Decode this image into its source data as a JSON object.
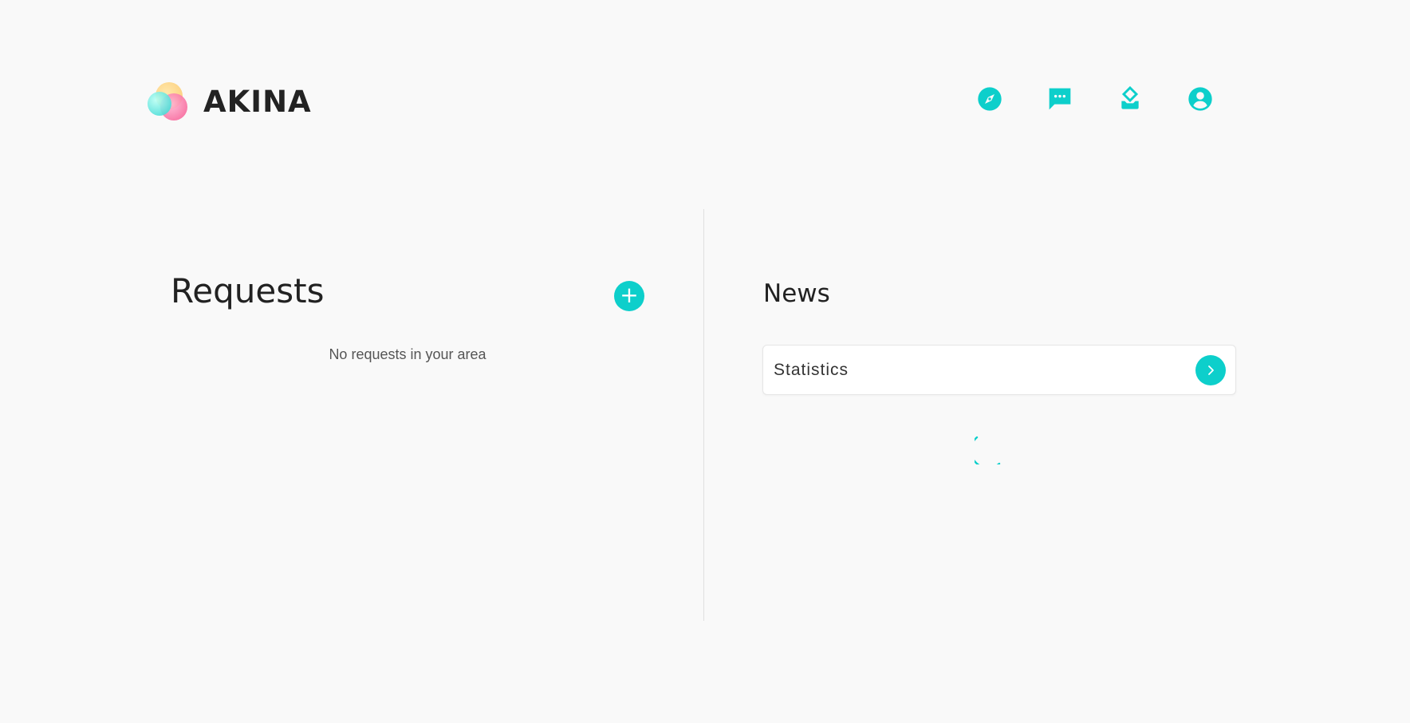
{
  "brand": {
    "name": "AKINA",
    "logo_icon": "akina-logo-icon"
  },
  "nav": {
    "items": [
      {
        "icon": "compass-icon",
        "label": ""
      },
      {
        "icon": "chat-icon",
        "label": ""
      },
      {
        "icon": "vote-icon",
        "label": ""
      },
      {
        "icon": "account-icon",
        "label": ""
      }
    ]
  },
  "requests": {
    "title": "Requests",
    "add_icon": "plus-icon",
    "add_symbol": "+",
    "empty_message": "No requests in your area"
  },
  "news": {
    "title": "News",
    "items": [
      {
        "label": "Statistics",
        "icon": "chevron-right-icon"
      }
    ],
    "loading_icon": "spinner-icon"
  },
  "colors": {
    "accent": "#0dcfcb",
    "background": "#f9f9f9",
    "text": "#222222",
    "muted": "#555555"
  }
}
